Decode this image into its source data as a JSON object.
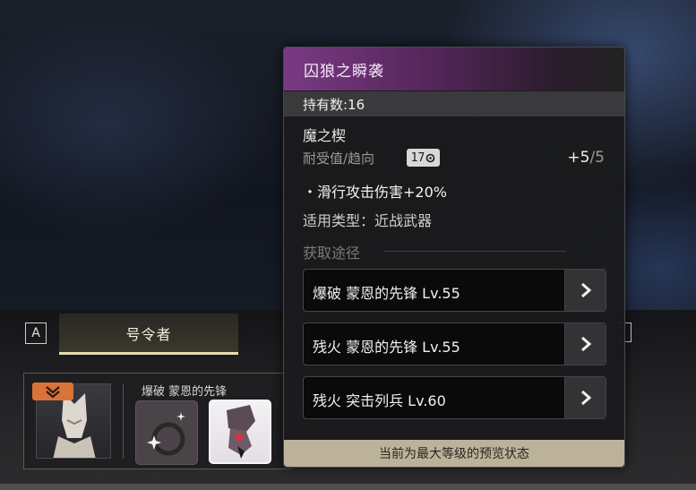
{
  "bottom_bar": {
    "key_hint": "A",
    "tab_label": "号令者",
    "loadout_label": "爆破 蒙恩的先锋"
  },
  "popup": {
    "title": "囚狼之瞬袭",
    "own_count": "持有数:16",
    "mod_set": "魔之楔",
    "capacity_label": "耐受值/趋向",
    "capacity_value": "17",
    "rank_current": "+5",
    "rank_max": "/5",
    "effect": "・滑行攻击伤害+20%",
    "applicable_type": "适用类型：近战武器",
    "source_heading": "获取途径",
    "sources": [
      {
        "label": "爆破 蒙恩的先锋 Lv.55"
      },
      {
        "label": "残火 蒙恩的先锋 Lv.55"
      },
      {
        "label": "残火 突击列兵 Lv.60"
      }
    ],
    "footer": "当前为最大等级的预览状态"
  },
  "icons": {
    "go": "chevron-right-icon",
    "polarity": "polarity-circle-icon",
    "badge": "chevron-down-icon"
  },
  "colors": {
    "header_purple": "#7a3a83",
    "footer_tan": "#bcb29a",
    "badge_orange": "#d9733a"
  }
}
